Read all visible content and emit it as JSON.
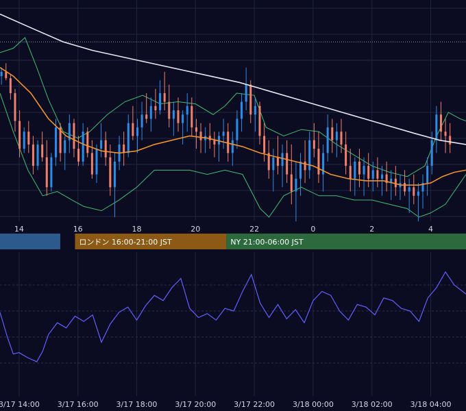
{
  "chart_data": [
    {
      "type": "line",
      "subtype": "candlestick-with-indicators",
      "x_tick_labels": [
        "14",
        "16",
        "18",
        "20",
        "22",
        "0",
        "2",
        "4"
      ],
      "x_hours": [
        14,
        16,
        18,
        20,
        22,
        24,
        26,
        28
      ],
      "xlim_hours": [
        13.35,
        29.2
      ],
      "ylim": [
        0,
        100
      ],
      "grid": true,
      "dotted_reference_level": 82,
      "series": [
        {
          "color": "#e8e8f0",
          "x": [
            13.35,
            14.5,
            15.5,
            16.5,
            17.5,
            18.5,
            19.5,
            20.5,
            21.5,
            22.5,
            23.5,
            24.5,
            25.5,
            26.5,
            27.5,
            28.3,
            29.2
          ],
          "values": [
            95,
            88,
            82,
            78,
            75,
            72,
            69,
            66,
            63,
            59,
            55,
            51,
            47,
            43,
            39,
            36,
            34
          ]
        },
        {
          "color": "#f0922c",
          "x": [
            13.35,
            13.8,
            14.4,
            15.0,
            15.6,
            16.2,
            16.8,
            17.4,
            18.0,
            18.6,
            19.2,
            19.8,
            20.4,
            21.0,
            21.6,
            22.2,
            22.8,
            23.4,
            24.0,
            24.6,
            25.2,
            25.8,
            26.4,
            27.0,
            27.6,
            28.0,
            28.4,
            28.8,
            29.2
          ],
          "values": [
            70,
            66,
            58,
            46,
            38,
            34,
            31,
            30,
            31,
            34,
            36,
            38,
            37,
            35,
            33,
            30,
            28,
            26,
            24,
            20,
            18,
            17,
            17,
            15,
            15,
            16,
            19,
            21,
            22
          ]
        },
        {
          "color": "#3fbf70",
          "x": [
            13.35,
            13.8,
            14.2,
            14.6,
            15.0,
            15.5,
            16.0,
            16.4,
            17.0,
            17.6,
            18.2,
            18.8,
            19.4,
            20.0,
            20.6,
            21.0,
            21.4,
            22.0,
            22.4,
            23.0,
            23.6,
            24.2,
            24.8,
            25.4,
            26.0,
            26.6,
            27.2,
            27.8,
            28.2,
            28.6,
            29.0,
            29.2
          ],
          "values": [
            77,
            79,
            84,
            70,
            55,
            40,
            37,
            40,
            48,
            54,
            57,
            53,
            54,
            53,
            48,
            52,
            58,
            57,
            42,
            38,
            41,
            40,
            34,
            29,
            24,
            21,
            19,
            24,
            38,
            49,
            46,
            45
          ]
        },
        {
          "color": "#3fbf70",
          "x": [
            13.35,
            13.8,
            14.3,
            14.8,
            15.3,
            15.8,
            16.2,
            16.8,
            17.4,
            18.0,
            18.6,
            19.2,
            19.8,
            20.4,
            21.0,
            21.6,
            22.2,
            22.5,
            23.0,
            23.6,
            24.2,
            24.8,
            25.4,
            26.0,
            26.6,
            27.2,
            27.6,
            28.0,
            28.5,
            29.0,
            29.2
          ],
          "values": [
            58,
            40,
            22,
            10,
            12,
            8,
            5,
            3,
            8,
            14,
            22,
            22,
            22,
            20,
            22,
            20,
            4,
            0,
            10,
            14,
            10,
            10,
            8,
            8,
            6,
            4,
            0,
            2,
            6,
            16,
            20
          ]
        },
        {
          "color": "#6060ff",
          "x": [
            13.35,
            13.6,
            13.8,
            14.0,
            14.3,
            14.6,
            14.8,
            15.0,
            15.3,
            15.6,
            15.9,
            16.2,
            16.5,
            16.8,
            17.1,
            17.4,
            17.7,
            18.0,
            18.3,
            18.6,
            18.9,
            19.2,
            19.5,
            19.8,
            20.1,
            20.4,
            20.7,
            21.0,
            21.3,
            21.6,
            21.9,
            22.2,
            22.5,
            22.8,
            23.1,
            23.4,
            23.7,
            24.0,
            24.3,
            24.6,
            24.9,
            25.2,
            25.5,
            25.8,
            26.1,
            26.4,
            26.7,
            27.0,
            27.3,
            27.6,
            27.9,
            28.2,
            28.5,
            28.8,
            29.2
          ],
          "values": [
            [
              59,
              40,
              27,
              28,
              24,
              21,
              29,
              42,
              51,
              47,
              56,
              52,
              57,
              36,
              50,
              59,
              63,
              53,
              64,
              72,
              68,
              78,
              85,
              62,
              55,
              58,
              53,
              62,
              60,
              75,
              88,
              66,
              55,
              65,
              54,
              61,
              51,
              68,
              75,
              72,
              60,
              53,
              65,
              63,
              57,
              70,
              68,
              62,
              60,
              52,
              70,
              78,
              90,
              80,
              73
            ]
          ]
        }
      ]
    },
    {
      "type": "line",
      "x_tick_labels": [
        "3/17 14:00",
        "3/17 16:00",
        "3/17 18:00",
        "3/17 20:00",
        "3/17 22:00",
        "3/18 00:00",
        "3/18 02:00",
        "3/18 04:00"
      ],
      "x_hours": [
        14,
        16,
        18,
        20,
        22,
        24,
        26,
        28
      ],
      "xlim_hours": [
        13.35,
        29.2
      ],
      "ylim": [
        0,
        100
      ],
      "grid": true,
      "series": [
        {
          "color": "#6060ff",
          "x": [
            13.35,
            13.6,
            13.8,
            14.0,
            14.3,
            14.6,
            14.8,
            15.0,
            15.3,
            15.6,
            15.9,
            16.2,
            16.5,
            16.8,
            17.1,
            17.4,
            17.7,
            18.0,
            18.3,
            18.6,
            18.9,
            19.2,
            19.5,
            19.8,
            20.1,
            20.4,
            20.7,
            21.0,
            21.3,
            21.6,
            21.9,
            22.2,
            22.5,
            22.8,
            23.1,
            23.4,
            23.7,
            24.0,
            24.3,
            24.6,
            24.9,
            25.2,
            25.5,
            25.8,
            26.1,
            26.4,
            26.7,
            27.0,
            27.3,
            27.6,
            27.9,
            28.2,
            28.5,
            28.8,
            29.2
          ],
          "values": [
            59,
            40,
            27,
            28,
            24,
            21,
            29,
            42,
            51,
            47,
            56,
            52,
            57,
            36,
            50,
            59,
            63,
            53,
            64,
            72,
            68,
            78,
            85,
            62,
            55,
            58,
            53,
            62,
            60,
            75,
            88,
            66,
            55,
            65,
            54,
            61,
            51,
            68,
            75,
            72,
            60,
            53,
            65,
            63,
            57,
            70,
            68,
            62,
            60,
            52,
            70,
            78,
            90,
            80,
            73
          ]
        }
      ]
    }
  ],
  "candles": {
    "up_color": "#2b8de8",
    "down_color": "#f0826c",
    "x_start_hours": 13.4,
    "x_step_hours": 0.0833,
    "ohlc": [
      [
        66,
        70,
        62,
        68
      ],
      [
        68,
        72,
        64,
        65
      ],
      [
        65,
        67,
        55,
        58
      ],
      [
        58,
        60,
        40,
        45
      ],
      [
        45,
        50,
        28,
        32
      ],
      [
        32,
        42,
        30,
        40
      ],
      [
        40,
        45,
        30,
        34
      ],
      [
        34,
        38,
        20,
        24
      ],
      [
        24,
        36,
        22,
        34
      ],
      [
        34,
        40,
        26,
        28
      ],
      [
        28,
        36,
        10,
        14
      ],
      [
        14,
        30,
        12,
        28
      ],
      [
        28,
        46,
        24,
        42
      ],
      [
        42,
        44,
        26,
        30
      ],
      [
        30,
        38,
        22,
        36
      ],
      [
        36,
        48,
        30,
        44
      ],
      [
        44,
        46,
        28,
        32
      ],
      [
        32,
        38,
        24,
        26
      ],
      [
        26,
        44,
        24,
        40
      ],
      [
        40,
        42,
        28,
        30
      ],
      [
        30,
        36,
        18,
        20
      ],
      [
        20,
        34,
        16,
        32
      ],
      [
        32,
        44,
        28,
        36
      ],
      [
        36,
        40,
        24,
        28
      ],
      [
        28,
        34,
        10,
        14
      ],
      [
        14,
        30,
        0,
        26
      ],
      [
        26,
        38,
        22,
        34
      ],
      [
        34,
        40,
        24,
        30
      ],
      [
        30,
        48,
        28,
        44
      ],
      [
        44,
        52,
        36,
        38
      ],
      [
        38,
        46,
        30,
        42
      ],
      [
        42,
        54,
        36,
        48
      ],
      [
        48,
        58,
        44,
        46
      ],
      [
        46,
        56,
        40,
        52
      ],
      [
        52,
        60,
        46,
        50
      ],
      [
        50,
        64,
        48,
        58
      ],
      [
        58,
        68,
        50,
        54
      ],
      [
        54,
        62,
        42,
        46
      ],
      [
        46,
        54,
        38,
        50
      ],
      [
        50,
        56,
        40,
        44
      ],
      [
        44,
        50,
        34,
        48
      ],
      [
        48,
        58,
        40,
        52
      ],
      [
        52,
        56,
        38,
        42
      ],
      [
        42,
        46,
        32,
        40
      ],
      [
        40,
        44,
        30,
        36
      ],
      [
        36,
        42,
        30,
        38
      ],
      [
        38,
        44,
        32,
        36
      ],
      [
        36,
        40,
        28,
        34
      ],
      [
        34,
        40,
        26,
        38
      ],
      [
        38,
        46,
        32,
        40
      ],
      [
        40,
        44,
        26,
        30
      ],
      [
        30,
        40,
        24,
        36
      ],
      [
        36,
        50,
        32,
        46
      ],
      [
        46,
        58,
        40,
        54
      ],
      [
        54,
        70,
        50,
        62
      ],
      [
        62,
        64,
        44,
        48
      ],
      [
        48,
        56,
        40,
        52
      ],
      [
        52,
        54,
        34,
        38
      ],
      [
        38,
        44,
        26,
        30
      ],
      [
        30,
        36,
        18,
        22
      ],
      [
        22,
        32,
        12,
        28
      ],
      [
        28,
        38,
        20,
        24
      ],
      [
        24,
        34,
        14,
        30
      ],
      [
        30,
        36,
        16,
        20
      ],
      [
        20,
        34,
        6,
        12
      ],
      [
        12,
        26,
        -2,
        18
      ],
      [
        18,
        30,
        10,
        26
      ],
      [
        26,
        36,
        16,
        22
      ],
      [
        22,
        40,
        18,
        36
      ],
      [
        36,
        44,
        28,
        32
      ],
      [
        32,
        40,
        16,
        20
      ],
      [
        20,
        34,
        12,
        30
      ],
      [
        30,
        48,
        26,
        42
      ],
      [
        42,
        46,
        30,
        36
      ],
      [
        36,
        44,
        28,
        40
      ],
      [
        40,
        46,
        30,
        34
      ],
      [
        34,
        40,
        20,
        24
      ],
      [
        24,
        32,
        12,
        18
      ],
      [
        18,
        28,
        10,
        26
      ],
      [
        26,
        32,
        14,
        20
      ],
      [
        20,
        28,
        10,
        24
      ],
      [
        24,
        30,
        14,
        18
      ],
      [
        18,
        26,
        12,
        22
      ],
      [
        22,
        28,
        14,
        18
      ],
      [
        18,
        24,
        10,
        20
      ],
      [
        20,
        26,
        12,
        16
      ],
      [
        16,
        22,
        8,
        18
      ],
      [
        18,
        24,
        10,
        14
      ],
      [
        14,
        20,
        8,
        16
      ],
      [
        16,
        22,
        10,
        12
      ],
      [
        12,
        18,
        2,
        14
      ],
      [
        14,
        20,
        6,
        10
      ],
      [
        10,
        16,
        -2,
        12
      ],
      [
        12,
        20,
        4,
        16
      ],
      [
        16,
        28,
        10,
        24
      ],
      [
        24,
        40,
        20,
        36
      ],
      [
        36,
        52,
        30,
        48
      ],
      [
        48,
        54,
        36,
        40
      ],
      [
        40,
        46,
        30,
        38
      ],
      [
        38,
        44,
        30,
        34
      ]
    ]
  },
  "sessions": {
    "london_label": "ロンドン 16:00-21:00 JST",
    "ny_label": "NY 21:00-06:00 JST"
  },
  "colors": {
    "background": "#0b0c22",
    "grid": "#232441",
    "tokyo_session": "#2c5a8c",
    "london_session": "#8c5a14",
    "ny_session": "#2c6a3e"
  }
}
